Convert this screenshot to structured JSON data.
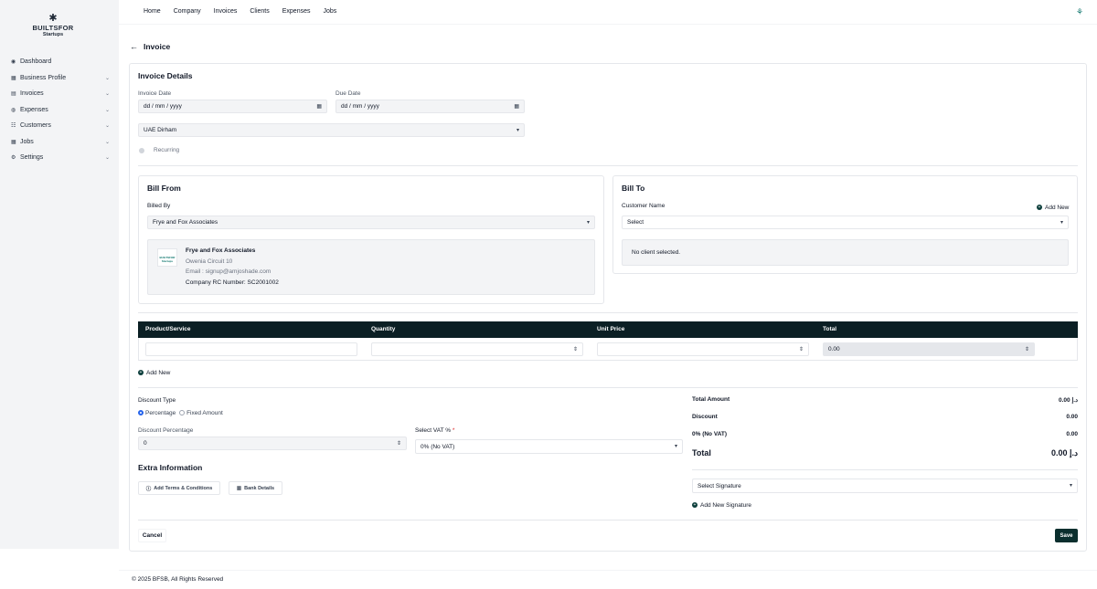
{
  "brand": {
    "line1": "BUILTSFOR",
    "line2": "Startups",
    "star": "✱"
  },
  "sidebar": {
    "items": [
      {
        "label": "Dashboard",
        "icon": "dashboard-icon",
        "glyph": "◉",
        "chevron": ""
      },
      {
        "label": "Business Profile",
        "icon": "grid-icon",
        "glyph": "▦",
        "chevron": "⌄"
      },
      {
        "label": "Invoices",
        "icon": "invoice-icon",
        "glyph": "▤",
        "chevron": "⌄"
      },
      {
        "label": "Expenses",
        "icon": "expense-icon",
        "glyph": "◍",
        "chevron": "⌄"
      },
      {
        "label": "Customers",
        "icon": "customers-icon",
        "glyph": "☷",
        "chevron": "⌄"
      },
      {
        "label": "Jobs",
        "icon": "jobs-icon",
        "glyph": "▦",
        "chevron": "⌄"
      },
      {
        "label": "Settings",
        "icon": "gear-icon",
        "glyph": "⚙",
        "chevron": "⌄"
      }
    ]
  },
  "topnav": [
    "Home",
    "Company",
    "Invoices",
    "Clients",
    "Expenses",
    "Jobs"
  ],
  "page": {
    "back": "←",
    "title": "Invoice"
  },
  "details": {
    "title": "Invoice Details",
    "invoice_date_label": "Invoice Date",
    "invoice_date_value": "dd / mm / yyyy",
    "due_date_label": "Due Date",
    "due_date_value": "dd / mm / yyyy",
    "currency": "UAE Dirham",
    "recurring": "Recurring"
  },
  "bill_from": {
    "title": "Bill From",
    "billed_by_label": "Billed By",
    "billed_by_value": "Frye and Fox Associates",
    "company_name": "Frye and Fox Associates",
    "address": "Owenia Circuit 10",
    "email": "Email : signup@amjoshade.com",
    "rc": "Company RC Number: SC2001002",
    "logo_text": "BUILTSFOR Startups"
  },
  "bill_to": {
    "title": "Bill To",
    "customer_label": "Customer Name",
    "add_new": "Add New",
    "select_value": "Select",
    "empty": "No client selected."
  },
  "items_table": {
    "headers": [
      "Product/Service",
      "Quantity",
      "Unit Price",
      "Total"
    ],
    "total_value": "0.00",
    "add_new": "Add New"
  },
  "discount": {
    "type_label": "Discount Type",
    "opt_percentage": "Percentage",
    "opt_fixed": "Fixed Amount",
    "percentage_label": "Discount Percentage",
    "percentage_value": "0",
    "vat_label": "Select VAT %",
    "vat_required": "*",
    "vat_value": "0% (No VAT)"
  },
  "summary": {
    "total_amount_label": "Total Amount",
    "total_amount_value": "0.00 د.إ",
    "discount_label": "Discount",
    "discount_value": "0.00",
    "vat_label": "0% (No VAT)",
    "vat_value": "0.00",
    "total_label": "Total",
    "total_value": "0.00 د.إ"
  },
  "extra": {
    "title": "Extra Information",
    "terms_btn": "Add Terms & Conditions",
    "bank_btn": "Bank Details"
  },
  "signature": {
    "select": "Select Signature",
    "add_new": "Add New Signature"
  },
  "actions": {
    "cancel": "Cancel",
    "save": "Save"
  },
  "footer": "© 2025 BFSB, All Rights Reserved",
  "colors": {
    "accent": "#0b2f2e",
    "table_header": "#0b1f24",
    "radio": "#2563eb"
  }
}
